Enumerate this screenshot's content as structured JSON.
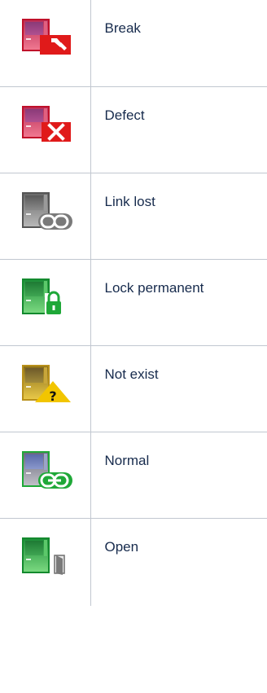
{
  "statuses": [
    {
      "label": "Break",
      "icon": "door-break-icon",
      "door_color": "#d23c55",
      "overlay_color": "#e01a1a"
    },
    {
      "label": "Defect",
      "icon": "door-defect-icon",
      "door_color": "#d23c55",
      "overlay_color": "#e01a1a"
    },
    {
      "label": "Link lost",
      "icon": "door-link-lost-icon",
      "door_color": "#8a8a8a",
      "overlay_color": "#6e6e6e"
    },
    {
      "label": "Lock permanent",
      "icon": "door-lock-permanent-icon",
      "door_color": "#2fb34a",
      "overlay_color": "#1fa838"
    },
    {
      "label": "Not exist",
      "icon": "door-not-exist-icon",
      "door_color": "#d6b61e",
      "overlay_color": "#f2c500"
    },
    {
      "label": "Normal",
      "icon": "door-normal-icon",
      "door_color": "#2fb34a",
      "overlay_color": "#1fa838"
    },
    {
      "label": "Open",
      "icon": "door-open-icon",
      "door_color": "#2fb34a",
      "overlay_color": "#7a7a7a"
    }
  ]
}
